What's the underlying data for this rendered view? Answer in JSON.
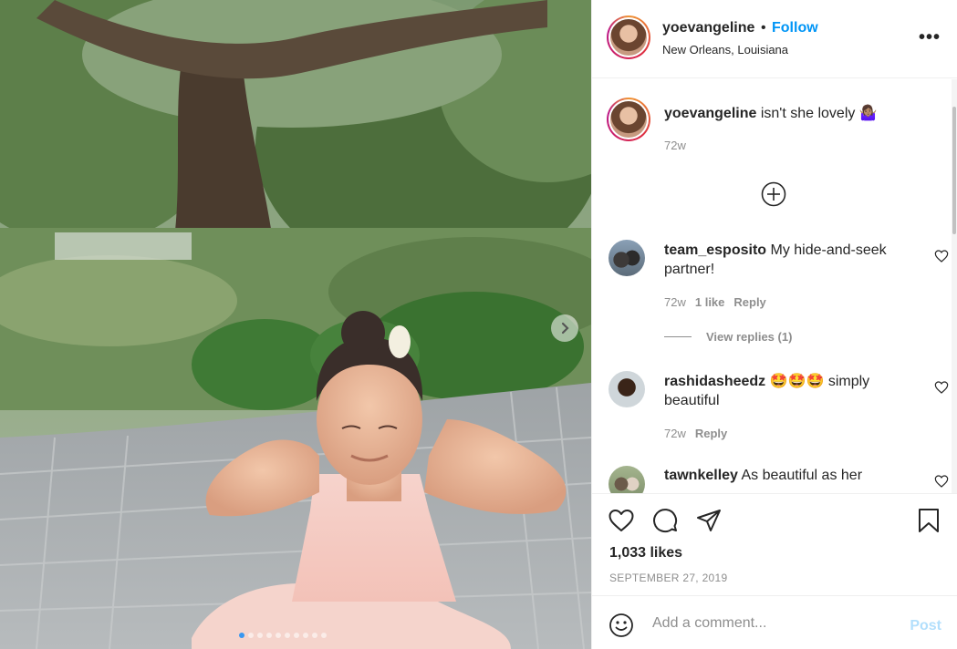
{
  "header": {
    "username": "yoevangeline",
    "separator": "•",
    "follow_label": "Follow",
    "location": "New Orleans, Louisiana",
    "more_label": "•••"
  },
  "caption": {
    "username": "yoevangeline",
    "text": "isn't she lovely 🤷🏽‍♀️",
    "age": "72w"
  },
  "comments": [
    {
      "username": "team_esposito",
      "text": "My hide-and-seek partner!",
      "age": "72w",
      "likes": "1 like",
      "reply": "Reply",
      "view_replies": "View replies (1)"
    },
    {
      "username": "rashidasheedz",
      "text": "🤩🤩🤩 simply beautiful",
      "age": "72w",
      "reply": "Reply"
    },
    {
      "username": "tawnkelley",
      "text": "As beautiful as her"
    }
  ],
  "actions": {
    "likes": "1,033 likes",
    "date": "SEPTEMBER 27, 2019"
  },
  "add_comment": {
    "placeholder": "Add a comment...",
    "post_label": "Post"
  },
  "carousel": {
    "slide_count": 10,
    "active_index": 0
  },
  "colors": {
    "follow": "#0095f6",
    "post_disabled": "#b2dffc",
    "muted": "#8e8e8e",
    "text": "#262626",
    "border": "#efefef"
  },
  "icons": [
    "chevron-right-icon",
    "more-icon",
    "plus-circle-icon",
    "heart-icon",
    "comment-icon",
    "share-icon",
    "bookmark-icon",
    "emoji-icon"
  ]
}
